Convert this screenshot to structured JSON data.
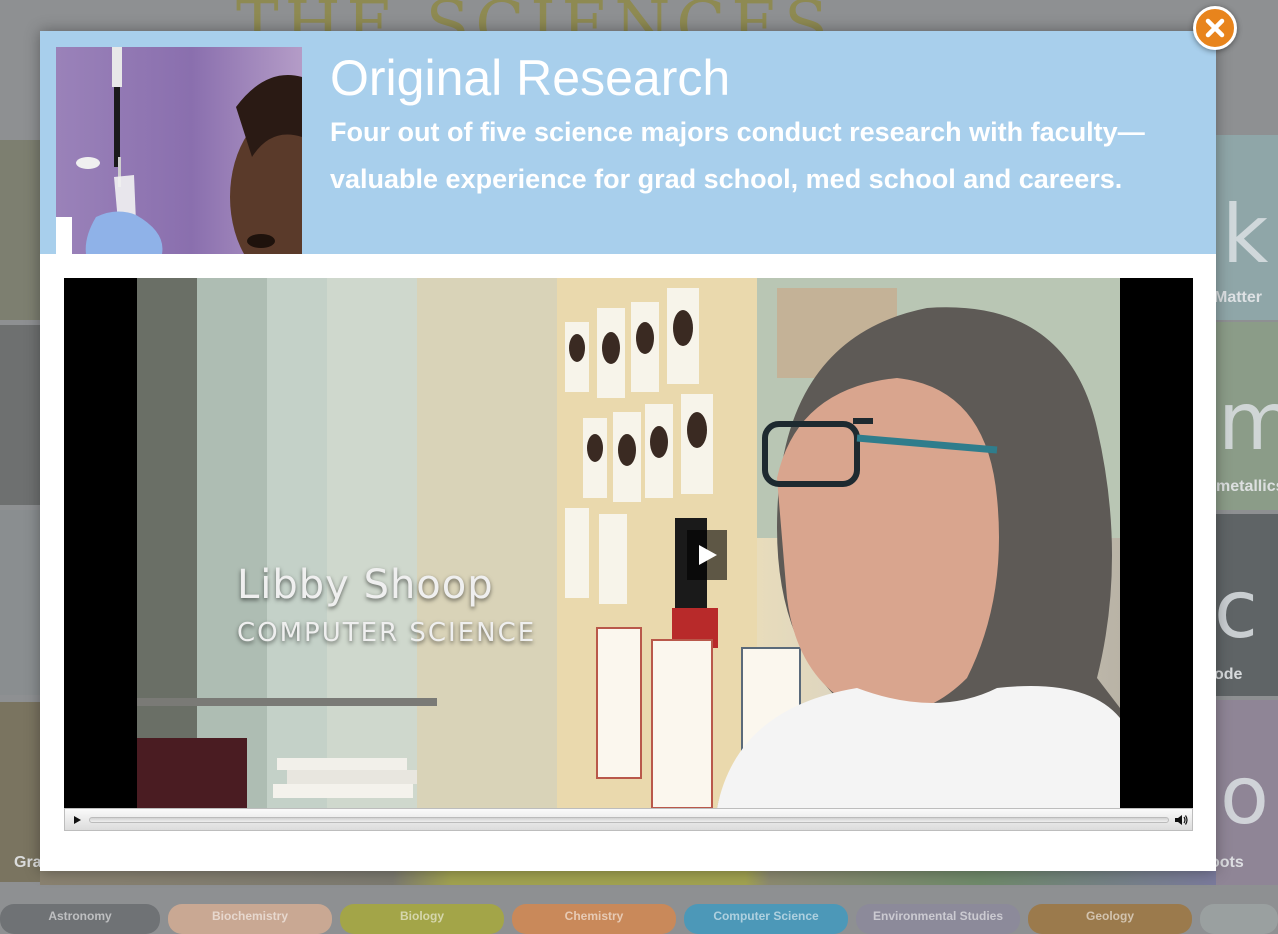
{
  "background": {
    "site_title": "THE SCIENCES",
    "tiles": [
      {
        "letter": "k",
        "caption": "Matter"
      },
      {
        "letter": "m",
        "caption": "metallics"
      },
      {
        "letter": "c",
        "caption": "ode"
      },
      {
        "letter": "o",
        "caption": "oots"
      }
    ],
    "left_caption": "Gra",
    "tabs": [
      {
        "label": "Astronomy",
        "color": "#6f7275"
      },
      {
        "label": "Biochemistry",
        "color": "#c9a893"
      },
      {
        "label": "Biology",
        "color": "#a3a548"
      },
      {
        "label": "Chemistry",
        "color": "#c9895a"
      },
      {
        "label": "Computer Science",
        "color": "#4c98b8"
      },
      {
        "label": "Environmental Studies",
        "color": "#8c8a9a"
      },
      {
        "label": "Geology",
        "color": "#9b7a4c"
      },
      {
        "label": "",
        "color": "#9aa0a0"
      }
    ]
  },
  "modal": {
    "title": "Original Research",
    "subtitle": "Four out of five science majors conduct research with faculty—valuable experience for grad school, med school and careers.",
    "video": {
      "lower_third_name": "Libby Shoop",
      "lower_third_department": "COMPUTER SCIENCE"
    }
  },
  "icons": {
    "close": "close-icon",
    "play_overlay": "play-icon",
    "controls_play": "play-icon",
    "volume": "volume-icon"
  },
  "colors": {
    "header_bg": "#a8cfec",
    "close_button": "#e8841c",
    "modal_bg": "#ffffff"
  }
}
